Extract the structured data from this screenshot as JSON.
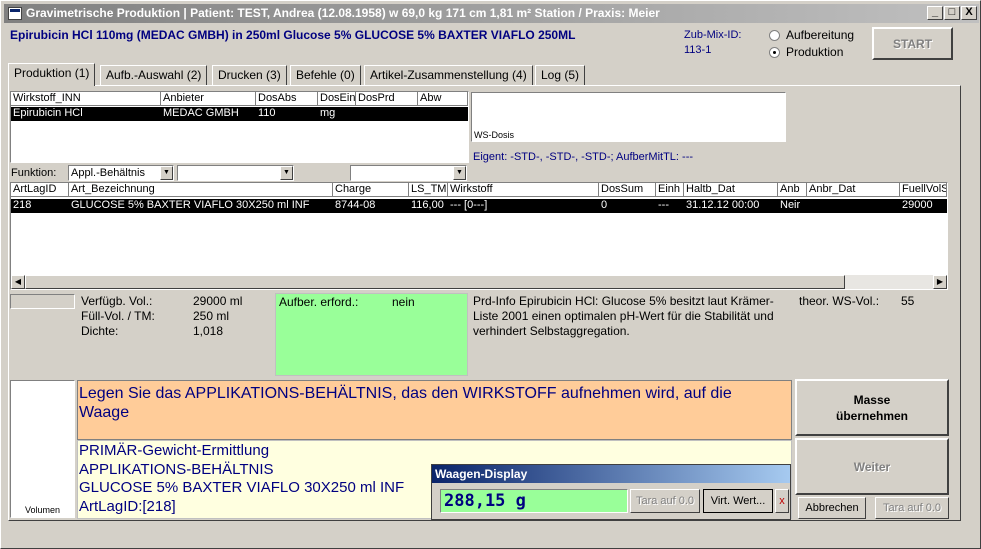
{
  "window": {
    "title": "Gravimetrische Produktion   |  Patient: TEST, Andrea (12.08.1958) w 69,0 kg  171 cm  1,81 m² Station / Praxis: Meier",
    "minimize": "_",
    "maximize": "□",
    "close": "X"
  },
  "header": {
    "product": "Epirubicin HCl 110mg (MEDAC GMBH) in 250ml Glucose 5% GLUCOSE 5% BAXTER VIAFLO 250ML",
    "zub_label": "Zub-Mix-ID:",
    "zub_value": "113-1",
    "radio_aufbereitung": "Aufbereitung",
    "radio_produktion": "Produktion",
    "start_button": "START"
  },
  "tabs": [
    {
      "label": "Produktion (1)"
    },
    {
      "label": "Aufb.-Auswahl (2)"
    },
    {
      "label": "Drucken (3)"
    },
    {
      "label": "Befehle (0)"
    },
    {
      "label": "Artikel-Zusammenstellung (4)"
    },
    {
      "label": "Log (5)"
    }
  ],
  "wirkstoff_grid": {
    "headers": [
      "Wirkstoff_INN",
      "Anbieter",
      "DosAbs",
      "DosEin",
      "DosPrd",
      "Abw"
    ],
    "row": [
      "Epirubicin HCl",
      "MEDAC GMBH",
      "110",
      "mg",
      "",
      ""
    ]
  },
  "ws_dosis_label": "WS-Dosis",
  "eigent": "Eigent: -STD-, -STD-, -STD-; AufberMitTL: ---",
  "funktion": {
    "label": "Funktion:",
    "combo1": "Appl.-Behältnis",
    "combo2": "",
    "combo3": ""
  },
  "artikel_grid": {
    "headers": [
      "ArtLagID",
      "Art_Bezeichnung",
      "Charge",
      "LS_TM",
      "Wirkstoff",
      "DosSum",
      "Einh",
      "Haltb_Dat",
      "Anb",
      "Anbr_Dat",
      "FuellVolS"
    ],
    "row": [
      "218",
      "GLUCOSE 5% BAXTER VIAFLO   30X250 ml INF",
      "8744-08",
      "116,00",
      "--- [0---]",
      "0",
      "---",
      "31.12.12 00:00",
      "Neir",
      "",
      "29000"
    ]
  },
  "volumes": {
    "verfuegb_label": "Verfügb. Vol.:",
    "verfuegb_value": "29000 ml",
    "fuell_label": "Füll-Vol. / TM:",
    "fuell_value": "250 ml",
    "dichte_label": "Dichte:",
    "dichte_value": "1,018"
  },
  "aufber": {
    "label": "Aufber. erford.:",
    "value": "nein"
  },
  "prd_info": "Prd-Info Epirubicin HCl: Glucose 5% besitzt laut Krämer-Liste 2001 einen optimalen pH-Wert für die Stabilität und verhindert Selbstaggregation.",
  "theor": {
    "label": "theor. WS-Vol.:",
    "value": "55"
  },
  "instruction": "Legen Sie das APPLIKATIONS-BEHÄLTNIS, das den WIRKSTOFF aufnehmen wird, auf die Waage",
  "detail_lines": [
    "PRIMÄR-Gewicht-Ermittlung",
    "APPLIKATIONS-BEHÄLTNIS",
    "GLUCOSE 5% BAXTER VIAFLO    30X250 ml INF",
    "ArtLagID:[218]"
  ],
  "volumen_label": "Volumen",
  "buttons": {
    "masse": "Masse übernehmen",
    "weiter": "Weiter",
    "abbrechen": "Abbrechen",
    "tara": "Tara auf 0.0"
  },
  "waagen": {
    "title": "Waagen-Display",
    "value": "288,15 g",
    "tara": "Tara auf 0.0",
    "virt": "Virt. Wert...",
    "close": "x"
  }
}
